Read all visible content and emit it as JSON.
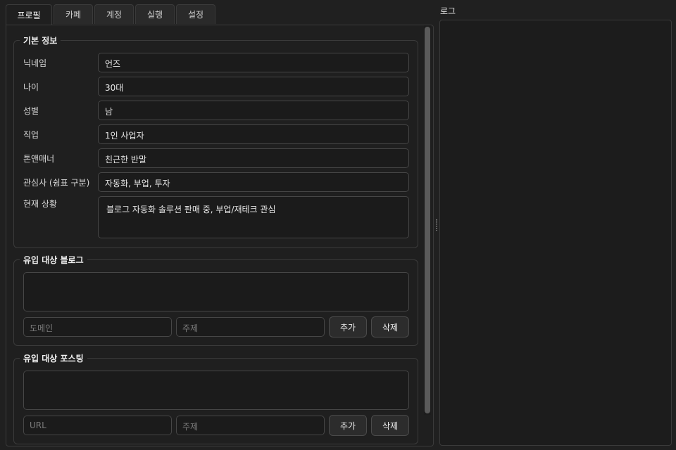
{
  "tabs": [
    "프로필",
    "카페",
    "계정",
    "실행",
    "설정"
  ],
  "basic": {
    "title": "기본 정보",
    "fields": [
      {
        "label": "닉네임",
        "value": "언즈"
      },
      {
        "label": "나이",
        "value": "30대"
      },
      {
        "label": "성별",
        "value": "남"
      },
      {
        "label": "직업",
        "value": "1인 사업자"
      },
      {
        "label": "톤앤매너",
        "value": "친근한 반말"
      },
      {
        "label": "관심사 (쉼표 구분)",
        "value": "자동화, 부업, 투자"
      }
    ],
    "situation": {
      "label": "현재 상황",
      "value": "블로그 자동화 솔루션 판매 중, 부업/재테크 관심"
    }
  },
  "blog": {
    "title": "유입 대상 블로그",
    "domain_placeholder": "도메인",
    "topic_placeholder": "주제",
    "add_label": "추가",
    "delete_label": "삭제"
  },
  "posting": {
    "title": "유입 대상 포스팅",
    "url_placeholder": "URL",
    "topic_placeholder": "주제",
    "add_label": "추가",
    "delete_label": "삭제"
  },
  "log": {
    "label": "로그"
  }
}
